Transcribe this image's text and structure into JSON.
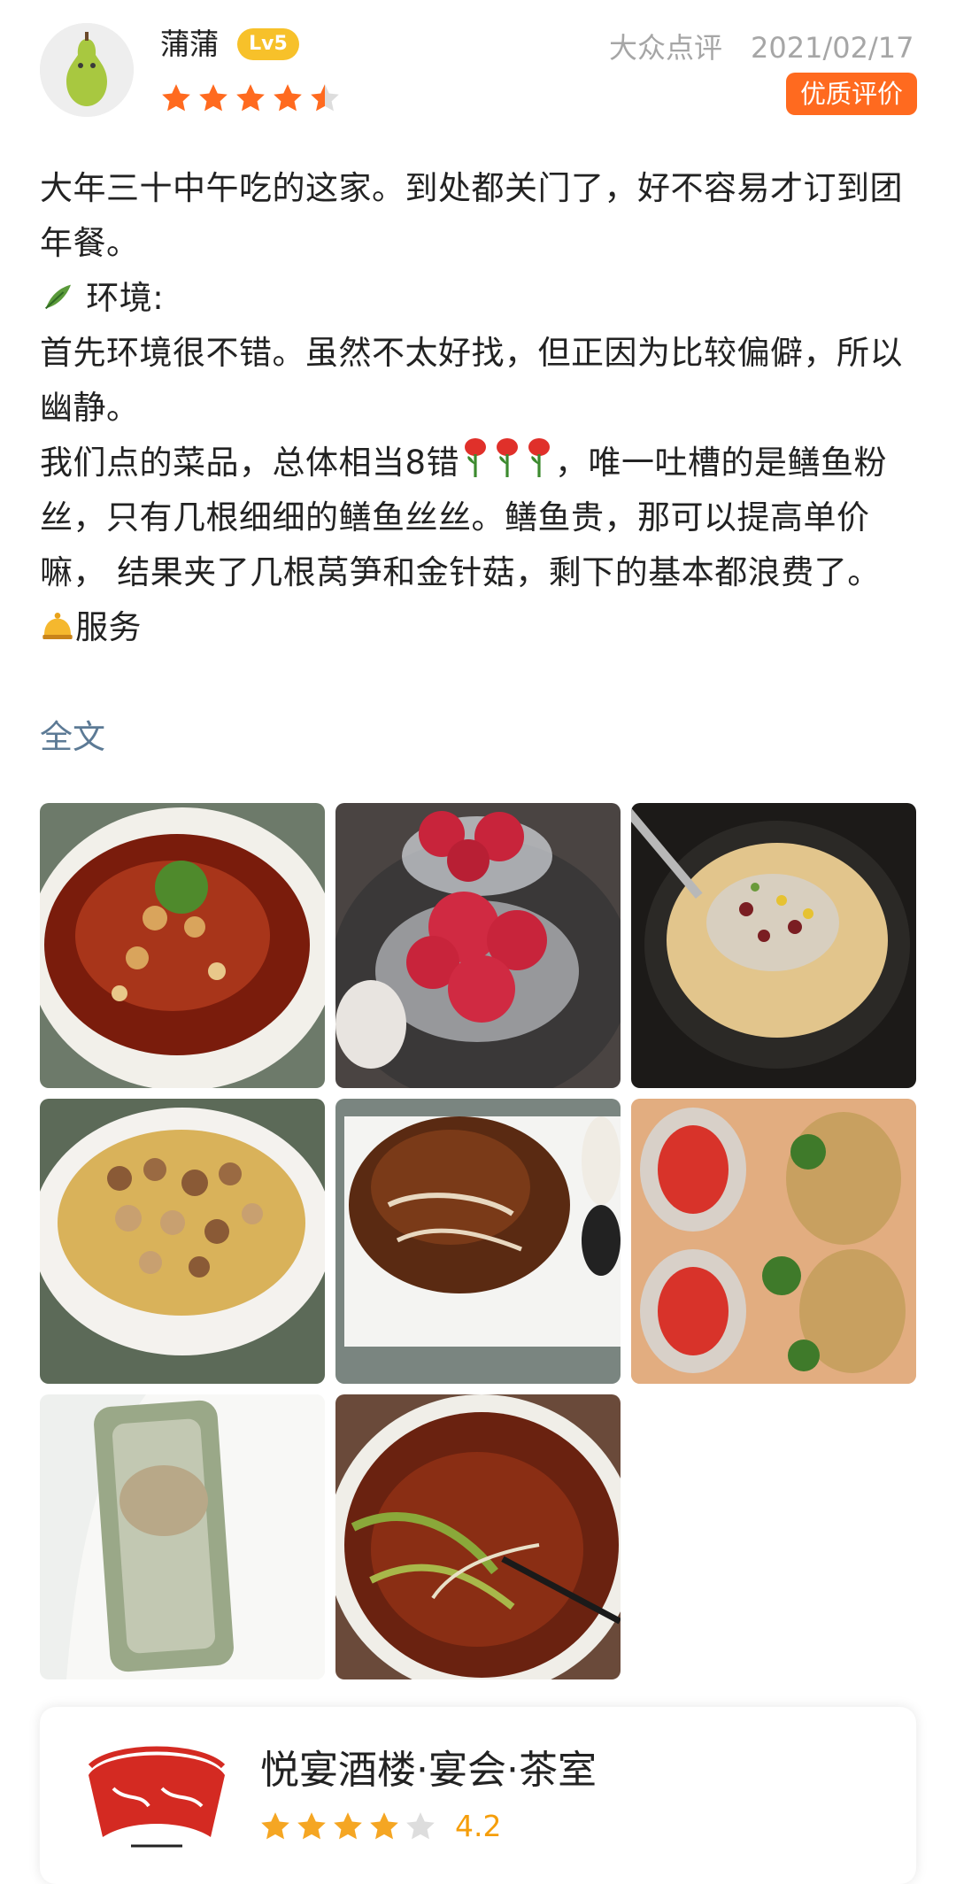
{
  "review": {
    "user": {
      "name": "蒲蒲",
      "level": "Lv5",
      "avatar_icon": "pear-avatar-icon",
      "rating": 4.5
    },
    "source": "大众点评",
    "date": "2021/02/17",
    "quality_badge": "优质评价",
    "paragraphs": [
      "大年三十中午吃的这家。到处都关门了，好不容易才订到团年餐。",
      "环境:",
      "首先环境很不错。虽然不太好找，但正因为比较偏僻，所以幽静。",
      "我们点的菜品，总体相当8错",
      "，唯一吐槽的是鳝鱼粉丝，只有几根细细的鳝鱼丝丝。鳝鱼贵，那可以提高单价嘛， 结果夹了几根莴笋和金针菇，剩下的基本都浪费了。",
      "服务"
    ],
    "icons": {
      "environment": "leaf-icon",
      "rose": "rose-icon",
      "service": "bell-icon"
    },
    "full_text_link": "全文",
    "photos": [
      "spicy-fish-dish",
      "red-glutinous-balls",
      "corn-porridge-pot",
      "meatball-soup",
      "roast-duck-slices",
      "steamed-scallops",
      "rice-cake-pastry",
      "spicy-eel-vermicelli"
    ]
  },
  "shop": {
    "name": "悦宴酒楼·宴会·茶室",
    "rating_value": 4,
    "rating_text": "4.2",
    "logo_icon": "shop-logo-icon"
  },
  "colors": {
    "star": "#ff6a1f",
    "shop_star": "#f5a623",
    "quality": "#ff6a1f",
    "link": "#5c7a95",
    "badge": "#f7c12a"
  }
}
